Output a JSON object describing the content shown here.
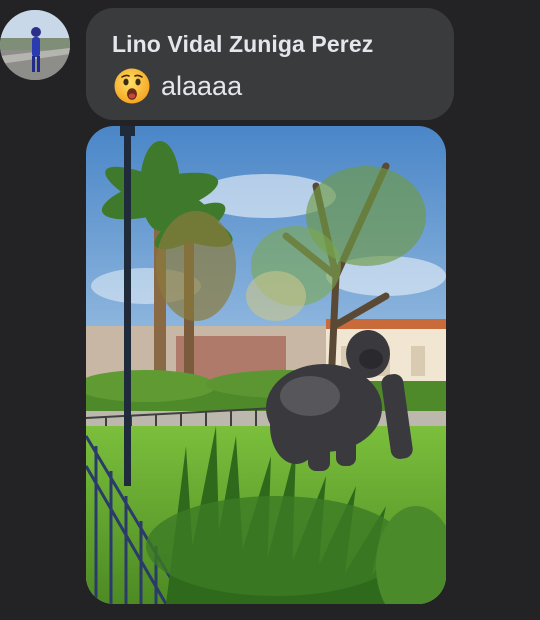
{
  "message": {
    "sender_name": "Lino Vidal Zuniga Perez",
    "text": "alaaaa",
    "emoji_icon": "surprised-face-emoji"
  },
  "avatar": {
    "icon": "profile-photo-person-outdoors"
  },
  "attachment": {
    "type": "photo",
    "description_icon": "park-photo-with-gorilla"
  },
  "colors": {
    "background": "#232325",
    "bubble": "#3a3b3d",
    "text": "#e4e6eb"
  }
}
